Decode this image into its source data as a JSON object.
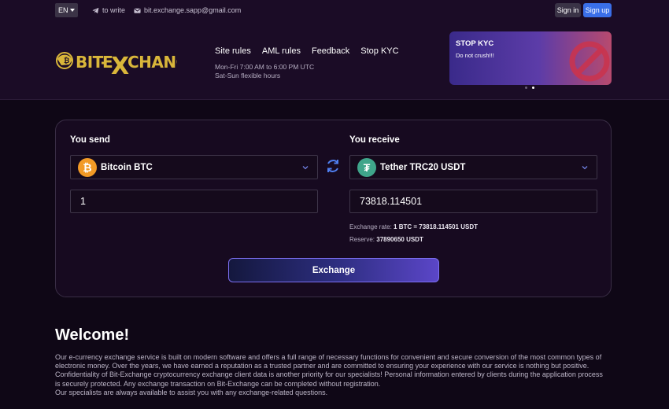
{
  "topbar": {
    "language": "EN",
    "write_link": "to write",
    "email": "bit.exchange.sapp@gmail.com",
    "sign_in": "Sign in",
    "sign_up": "Sign up"
  },
  "header": {
    "logo_text": "BIT-EXCHANGE",
    "nav": [
      "Site rules",
      "AML rules",
      "Feedback",
      "Stop KYC"
    ],
    "hours": [
      "Mon-Fri 7:00 AM to 6:00 PM UTC",
      "Sat-Sun flexible hours"
    ],
    "banner": {
      "title": "STOP KYC",
      "text": "Do not crush!!!"
    },
    "slider_dots": 2
  },
  "exchange": {
    "send_label": "You send",
    "receive_label": "You receive",
    "send_currency": "Bitcoin BTC",
    "receive_currency": "Tether TRC20 USDT",
    "send_amount": "1",
    "receive_amount": "73818.114501",
    "rate_label": "Exchange rate:",
    "rate_value": "1 BTC = 73818.114501 USDT",
    "reserve_label": "Reserve:",
    "reserve_value": "37890650 USDT",
    "button": "Exchange"
  },
  "welcome": {
    "title": "Welcome!",
    "paragraphs": [
      "Our e-currency exchange service is built on modern software and offers a full range of necessary functions for convenient and secure conversion of the most common types of electronic money. Over the years, we have earned a reputation as a trusted partner and are committed to ensuring your experience with our service is nothing but positive.",
      "Confidentiality of Bit-Exchange cryptocurrency exchange client data is another priority for our specialists! Personal information entered by clients during the application process is securely protected. Any exchange transaction on Bit-Exchange can be completed without registration.",
      "Our specialists are always available to assist you with any exchange-related questions."
    ]
  },
  "colors": {
    "background": "#0f0716",
    "header": "#1b0c26",
    "accent_blue": "#3a6fe8",
    "logo_gold": "#d9b63a",
    "btc": "#f29a26",
    "usdt": "#3fa58a"
  }
}
